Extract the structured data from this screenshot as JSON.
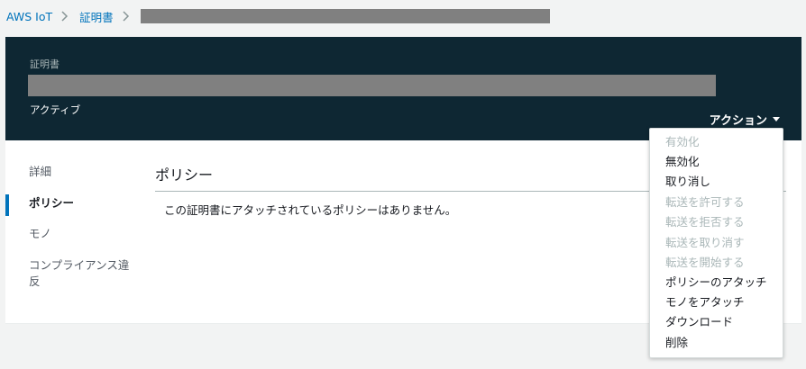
{
  "breadcrumb": {
    "root": "AWS IoT",
    "section": "証明書"
  },
  "header": {
    "label": "証明書",
    "status": "アクティブ",
    "action_label": "アクション"
  },
  "sidenav": {
    "items": [
      {
        "label": "詳細",
        "active": false
      },
      {
        "label": "ポリシー",
        "active": true
      },
      {
        "label": "モノ",
        "active": false
      },
      {
        "label": "コンプライアンス違反",
        "active": false
      }
    ]
  },
  "main": {
    "title": "ポリシー",
    "empty_message": "この証明書にアタッチされているポリシーはありません。"
  },
  "actions_menu": {
    "items": [
      {
        "label": "有効化",
        "enabled": false
      },
      {
        "label": "無効化",
        "enabled": true
      },
      {
        "label": "取り消し",
        "enabled": true
      },
      {
        "label": "転送を許可する",
        "enabled": false
      },
      {
        "label": "転送を拒否する",
        "enabled": false
      },
      {
        "label": "転送を取り消す",
        "enabled": false
      },
      {
        "label": "転送を開始する",
        "enabled": false
      },
      {
        "label": "ポリシーのアタッチ",
        "enabled": true
      },
      {
        "label": "モノをアタッチ",
        "enabled": true
      },
      {
        "label": "ダウンロード",
        "enabled": true
      },
      {
        "label": "削除",
        "enabled": true
      }
    ]
  },
  "colors": {
    "header_bg": "#0e2733",
    "link": "#0073bb",
    "page_bg": "#f2f3f3",
    "disabled_text": "#aab7b8"
  }
}
